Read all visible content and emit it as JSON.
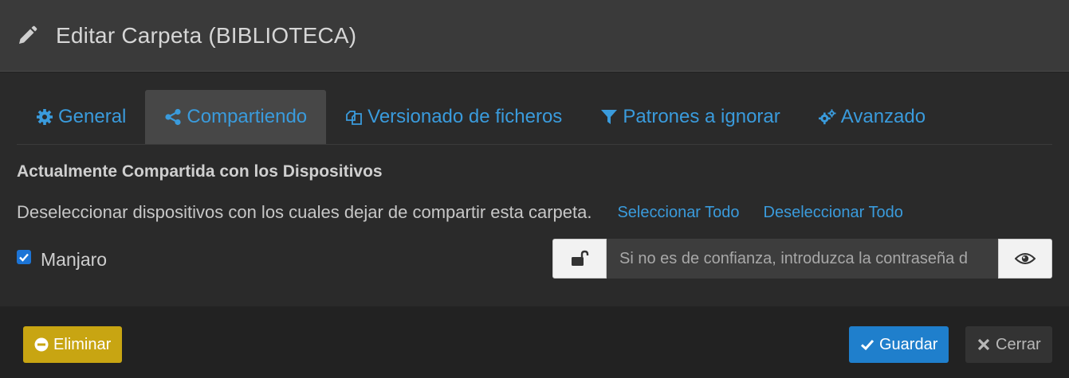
{
  "header": {
    "title": "Editar Carpeta (BIBLIOTECA)",
    "icon": "pencil-icon"
  },
  "tabs": [
    {
      "label": "General",
      "icon": "gear-icon",
      "active": false
    },
    {
      "label": "Compartiendo",
      "icon": "share-icon",
      "active": true
    },
    {
      "label": "Versionado de ficheros",
      "icon": "copy-icon",
      "active": false
    },
    {
      "label": "Patrones a ignorar",
      "icon": "filter-icon",
      "active": false
    },
    {
      "label": "Avanzado",
      "icon": "gears-icon",
      "active": false
    }
  ],
  "sharing": {
    "section_title": "Actualmente Compartida con los Dispositivos",
    "description": "Deseleccionar dispositivos con los cuales dejar de compartir esta carpeta.",
    "select_all": "Seleccionar Todo",
    "deselect_all": "Deseleccionar Todo",
    "devices": [
      {
        "name": "Manjaro",
        "checked": true,
        "password_placeholder": "Si no es de confianza, introduzca la contraseña d"
      }
    ]
  },
  "footer": {
    "delete_label": "Eliminar",
    "save_label": "Guardar",
    "close_label": "Cerrar"
  },
  "colors": {
    "accent": "#3a9bdc",
    "save": "#1f7fcc",
    "delete": "#c8a512"
  }
}
